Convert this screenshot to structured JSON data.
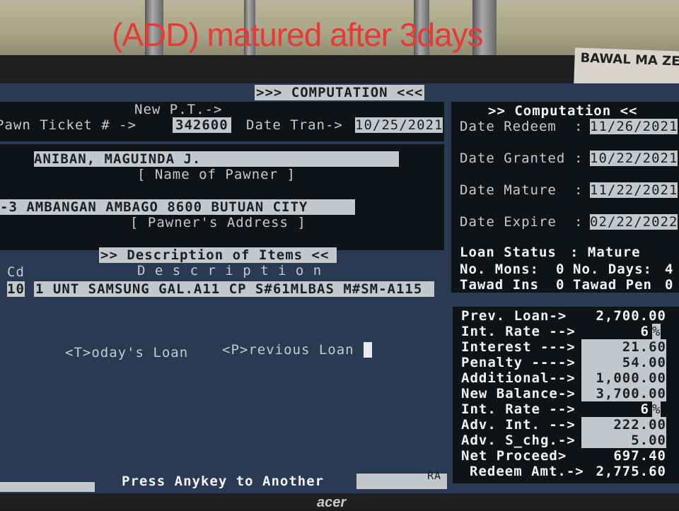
{
  "annotation": "(ADD) matured after 3days",
  "sticker": "BAWAL MA ZERO 'O",
  "header": {
    "title": ">>> COMPUTATION <<<"
  },
  "left": {
    "new_pt_label": "New P.T.->",
    "pawn_ticket_label": "Pawn Ticket # ->",
    "pawn_ticket_value": "342600",
    "date_tran_label": "Date Tran->",
    "date_tran_value": "10/25/2021",
    "pawner_name": "ANIBAN, MAGUINDA J.",
    "pawner_name_label": "[ Name of Pawner ]",
    "pawner_address": "-3 AMBANGAN AMBAGO 8600 BUTUAN CITY",
    "pawner_address_label": "[ Pawner's Address ]",
    "items_header": ">> Description of Items <<",
    "col_cd": "Cd",
    "col_description": "D e s c r i p t i o n",
    "items": [
      {
        "cd": "10",
        "description": "1 UNT SAMSUNG GAL.A11 CP S#61MLBAS M#SM-A115"
      }
    ],
    "todays_loan": "<T>oday's Loan",
    "previous_loan": "<P>revious Loan"
  },
  "right": {
    "title": ">> Computation <<",
    "date_redeem_label": "Date Redeem",
    "date_redeem": "11/26/2021",
    "date_granted_label": "Date Granted",
    "date_granted": "10/22/2021",
    "date_mature_label": "Date Mature",
    "date_mature": "11/22/2021",
    "date_expire_label": "Date Expire",
    "date_expire": "02/22/2022",
    "loan_status_label": "Loan Status",
    "loan_status": ": Mature",
    "no_mons_label": "No. Mons:",
    "no_mons": "0",
    "no_days_label": "No. Days:",
    "no_days": "4",
    "tawad_ins_label": "Tawad Ins",
    "tawad_ins": "0",
    "tawad_pen_label": "Tawad Pen",
    "tawad_pen": "0"
  },
  "summary": {
    "prev_loan_label": "Prev. Loan->",
    "prev_loan": "2,700.00",
    "int_rate_label": "Int. Rate -->",
    "int_rate": "6",
    "pct": "%",
    "interest_label": "Interest --->",
    "interest": "21.60",
    "penalty_label": "Penalty ---->",
    "penalty": "54.00",
    "additional_label": "Additional-->",
    "additional": "1,000.00",
    "new_balance_label": "New Balance->",
    "new_balance": "3,700.00",
    "int_rate2_label": "Int. Rate -->",
    "int_rate2": "6",
    "adv_int_label": "Adv. Int. -->",
    "adv_int": "222.00",
    "adv_schg_label": "Adv. S_chg.->",
    "adv_schg": "5.00",
    "net_proceed_label": "Net Proceed>",
    "net_proceed": "697.40",
    "redeem_amt_label": "Redeem Amt.->",
    "redeem_amt": "2,775.60"
  },
  "footer": {
    "prompt": "Press Anykey to Another",
    "ra": "RA"
  },
  "monitor_brand": "acer"
}
